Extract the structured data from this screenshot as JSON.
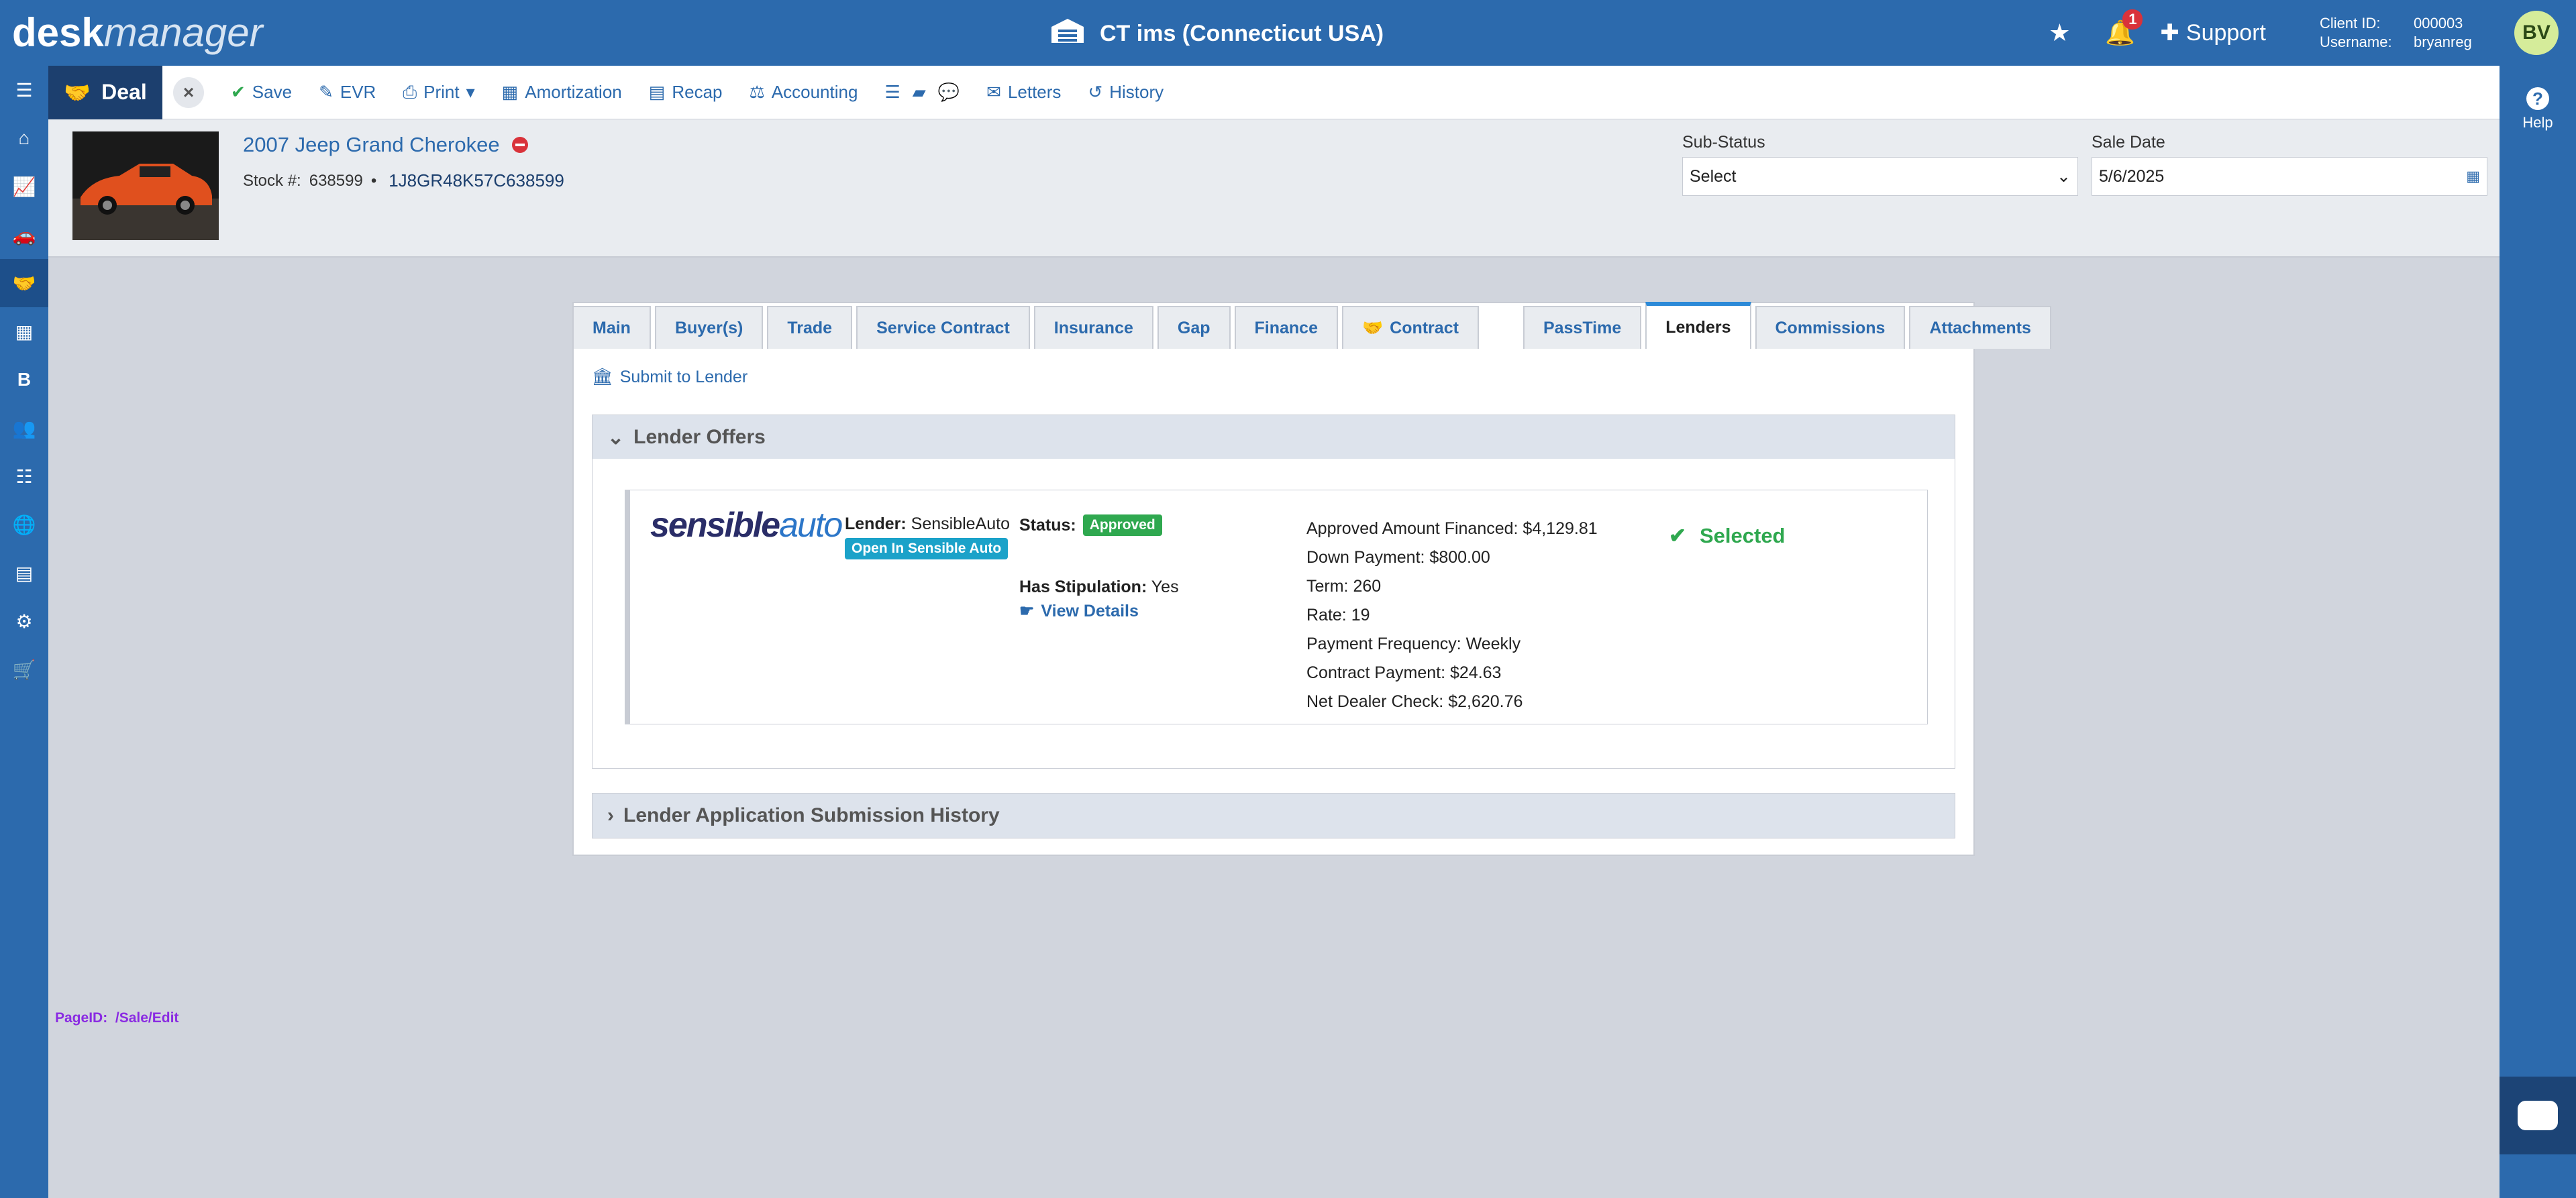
{
  "app": {
    "logo_bold": "desk",
    "logo_italic": "manager",
    "dealership": "CT ims (Connecticut USA)",
    "notification_count": "1",
    "support_label": "Support",
    "client_id_label": "Client ID:",
    "client_id": "000003",
    "username_label": "Username:",
    "username": "bryanreg",
    "avatar_initials": "BV",
    "help_label": "Help"
  },
  "sidebar": {
    "items": [
      {
        "icon": "menu-icon",
        "glyph": "☰"
      },
      {
        "icon": "home-icon",
        "glyph": "⌂"
      },
      {
        "icon": "chart-icon",
        "glyph": "📈"
      },
      {
        "icon": "car-icon",
        "glyph": "🚗"
      },
      {
        "icon": "handshake-icon",
        "glyph": "🤝"
      },
      {
        "icon": "cubes-icon",
        "glyph": "▦"
      },
      {
        "icon": "bold-b-icon",
        "glyph": "B"
      },
      {
        "icon": "users-icon",
        "glyph": "👥"
      },
      {
        "icon": "list-icon",
        "glyph": "☷"
      },
      {
        "icon": "globe-icon",
        "glyph": "🌐"
      },
      {
        "icon": "id-card-icon",
        "glyph": "▤"
      },
      {
        "icon": "gear-icon",
        "glyph": "⚙"
      },
      {
        "icon": "cart-icon",
        "glyph": "🛒"
      }
    ]
  },
  "toolbar": {
    "deal_label": "Deal",
    "save": "Save",
    "evr": "EVR",
    "print": "Print",
    "amortization": "Amortization",
    "recap": "Recap",
    "accounting": "Accounting",
    "letters": "Letters",
    "history": "History"
  },
  "vehicle": {
    "title": "2007 Jeep Grand Cherokee",
    "stock_label": "Stock #:",
    "stock": "638599",
    "separator": "•",
    "vin": "1J8GR48K57C638599"
  },
  "fields": {
    "substatus_label": "Sub-Status",
    "substatus_value": "Select",
    "saledate_label": "Sale Date",
    "saledate_value": "5/6/2025"
  },
  "tabs": [
    "Main",
    "Buyer(s)",
    "Trade",
    "Service Contract",
    "Insurance",
    "Gap",
    "Finance",
    "Contract",
    "PassTime",
    "Lenders",
    "Commissions",
    "Attachments"
  ],
  "lenders": {
    "submit_link": "Submit to Lender",
    "offers_title": "Lender Offers",
    "history_title": "Lender Application Submission History",
    "offer": {
      "logo_part1": "sensible",
      "logo_part2": "auto",
      "lender_label": "Lender:",
      "lender_name": "SensibleAuto",
      "open_button": "Open In Sensible Auto",
      "status_label": "Status:",
      "status_value": "Approved",
      "stipulation_label": "Has Stipulation:",
      "stipulation_value": "Yes",
      "view_details": "View Details",
      "approved_amount": "Approved Amount Financed: $4,129.81",
      "down_payment": "Down Payment: $800.00",
      "term": "Term: 260",
      "rate": "Rate: 19",
      "frequency": "Payment Frequency: Weekly",
      "contract_payment": "Contract Payment: $24.63",
      "net_dealer_check": "Net Dealer Check: $2,620.76",
      "selected_label": "Selected"
    }
  },
  "footer": {
    "pageid_label": "PageID:",
    "pageid_value": "/Sale/Edit"
  },
  "colors": {
    "brand_blue": "#2c6aad",
    "approved_green": "#2fa84f",
    "badge_red": "#d9323a"
  }
}
